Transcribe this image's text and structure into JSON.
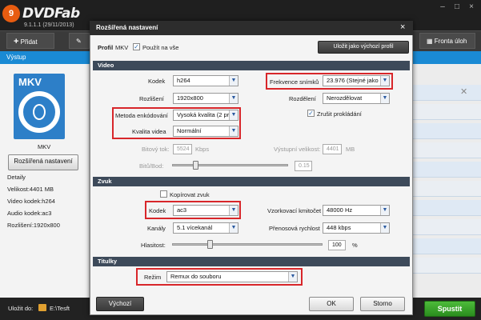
{
  "app": {
    "name": "DVDFab",
    "version": "9.1.1.1 (29/11/2013)",
    "badge": "9"
  },
  "toolbar": {
    "add": "Přidat",
    "queue": "Fronta úloh"
  },
  "sidebar": {
    "header": "Výstup",
    "format": "MKV",
    "format_caption": "MKV",
    "advanced_button": "Rozšířená nastavení",
    "details_title": "Detaily",
    "size": "Velikost:4401 MB",
    "video_codec": "Video kodek:h264",
    "audio_codec": "Audio kodek:ac3",
    "resolution": "Rozlišení:1920x800"
  },
  "footer": {
    "save_to": "Uložit do:",
    "path": "E:\\Tesft",
    "start": "Spustit"
  },
  "dialog": {
    "title": "Rozšířená nastavení",
    "profile_label": "Profil",
    "profile_value": "MKV",
    "apply_all": "Použít na vše",
    "save_default": "Uložit jako výchozí profil",
    "sections": {
      "video": "Video",
      "audio": "Zvuk",
      "subs": "Titulky"
    },
    "video": {
      "codec_label": "Kodek",
      "codec_value": "h264",
      "framerate_label": "Frekvence snímků",
      "framerate_value": "23.976 (Stejné jako z",
      "resolution_label": "Rozlišení",
      "resolution_value": "1920x800",
      "split_label": "Rozdělení",
      "split_value": "Nerozdělovat",
      "encode_label": "Metoda enkódování",
      "encode_value": "Vysoká kvalita (2 prů",
      "deinterlace_label": "Zrušit prokládání",
      "quality_label": "Kvalita videa",
      "quality_value": "Normální",
      "bitrate_label": "Bitový tok:",
      "bitrate_value": "5524",
      "bitrate_unit": "Kbps",
      "outsize_label": "Výstupní velikost:",
      "outsize_value": "4401",
      "outsize_unit": "MB",
      "bpp_label": "Bitů/Bod:",
      "bpp_value": "0.15",
      "bpp_fraction": 0.2
    },
    "audio": {
      "copy_label": "Kopírovat zvuk",
      "codec_label": "Kodek",
      "codec_value": "ac3",
      "samplerate_label": "Vzorkovací kmitočet",
      "samplerate_value": "48000 Hz",
      "channels_label": "Kanály",
      "channels_value": "5.1 vícekanál",
      "bitrate_label": "Přenosová rychlost",
      "bitrate_value": "448 kbps",
      "volume_label": "Hlasitost:",
      "volume_value": "100",
      "volume_unit": "%",
      "volume_fraction": 0.25
    },
    "subs": {
      "mode_label": "Režim",
      "mode_value": "Remux do souboru"
    },
    "buttons": {
      "default": "Výchozí",
      "ok": "OK",
      "cancel": "Storno"
    }
  }
}
